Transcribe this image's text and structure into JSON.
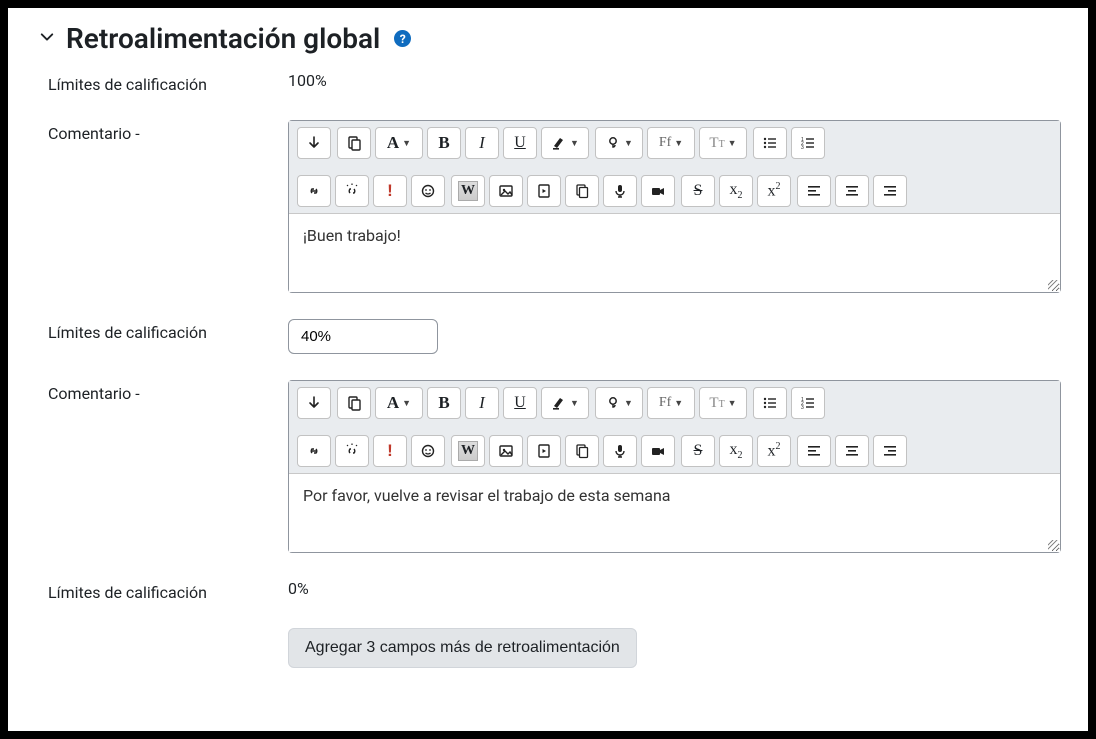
{
  "section": {
    "title": "Retroalimentación global"
  },
  "labels": {
    "boundary": "Límites de calificación",
    "comment": "Comentario -"
  },
  "boundaries": {
    "top": "100%",
    "mid": "40%",
    "bottom": "0%"
  },
  "comments": {
    "first": "¡Buen trabajo!",
    "second": "Por favor, vuelve a revisar el trabajo de esta semana"
  },
  "buttons": {
    "addMore": "Agregar 3 campos más de retroalimentación"
  }
}
